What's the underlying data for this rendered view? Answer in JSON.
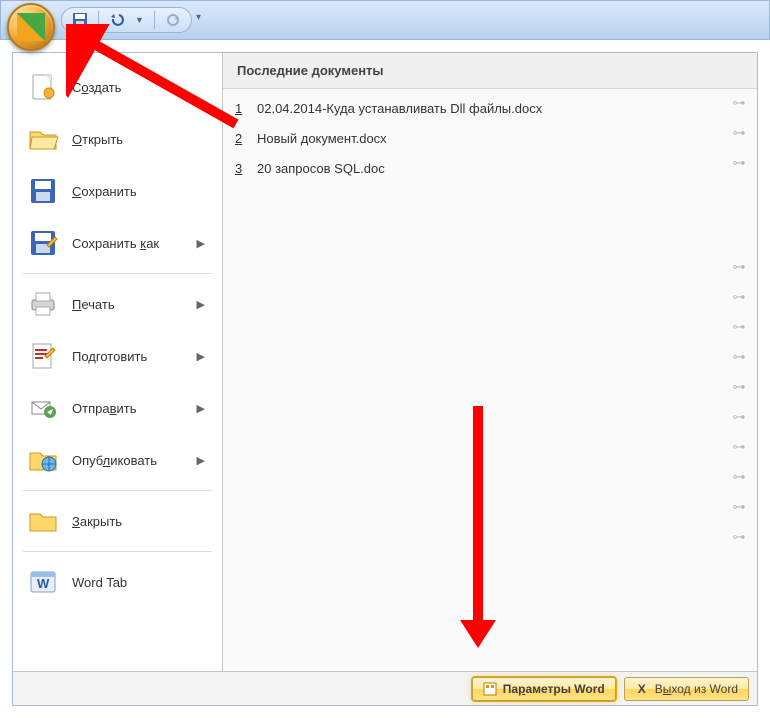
{
  "titlebar": {
    "qat": {
      "save_tip": "Сохранить",
      "undo_tip": "Отменить",
      "redo_tip": "Повторить"
    }
  },
  "menu": {
    "create": {
      "label": "Создать",
      "u": "о"
    },
    "open": {
      "label": "Открыть",
      "u": "О"
    },
    "save": {
      "label": "Сохранить",
      "u": "С"
    },
    "save_as": {
      "label": "Сохранить как",
      "u": "к"
    },
    "print": {
      "label": "Печать",
      "u": "П"
    },
    "prepare": {
      "label": "Подготовить",
      "u": "д"
    },
    "send": {
      "label": "Отправить",
      "u": "в"
    },
    "publish": {
      "label": "Опубликовать",
      "u": "л"
    },
    "close": {
      "label": "Закрыть",
      "u": "З"
    },
    "word_tab": {
      "label": "Word Tab"
    }
  },
  "recent": {
    "header": "Последние документы",
    "items": [
      {
        "n": "1",
        "name": "02.04.2014-Куда устанавливать Dll файлы.docx"
      },
      {
        "n": "2",
        "name": "Новый документ.docx"
      },
      {
        "n": "3",
        "name": "20 запросов SQL.doc"
      }
    ]
  },
  "footer": {
    "options_label": "Параметры Word",
    "options_u": "р",
    "exit_label": "Выход из Word",
    "exit_u": "ы"
  }
}
